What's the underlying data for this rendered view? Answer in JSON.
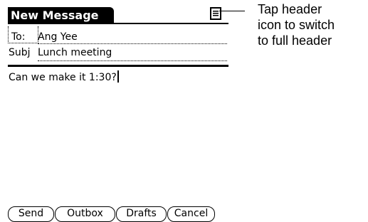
{
  "header": {
    "title": "New Message",
    "icon": "header-toggle-icon"
  },
  "callout": {
    "text": "Tap header\nicon to switch\nto full header"
  },
  "fields": {
    "to_label": "To:",
    "to_value": "Ang Yee",
    "subj_label": "Subj",
    "subj_value": "Lunch meeting"
  },
  "body": {
    "text": "Can we make it 1:30?"
  },
  "buttons": {
    "send": "Send",
    "outbox": "Outbox",
    "drafts": "Drafts",
    "cancel": "Cancel"
  }
}
